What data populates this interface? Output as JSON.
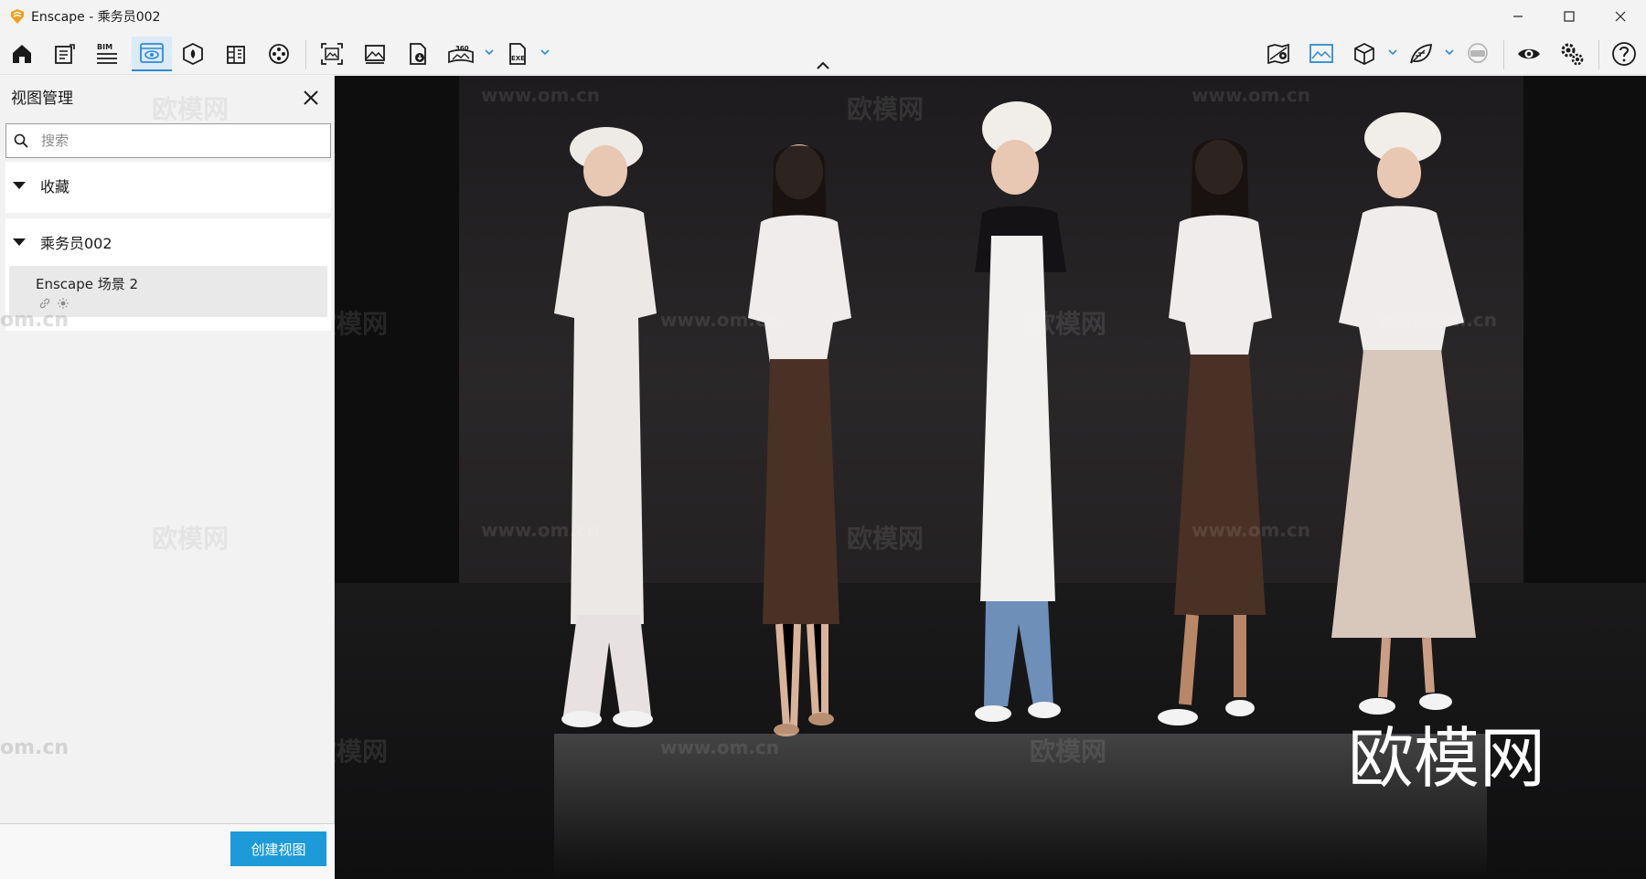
{
  "window": {
    "title": "Enscape - 乘务员002"
  },
  "icons": {
    "toolbar_left": [
      "home-icon",
      "notes-icon",
      "bim-icon",
      "view-management-icon",
      "asset-library-icon",
      "building-icon",
      "video-reel-icon",
      "screenshot-icon",
      "image-render-icon",
      "document-export-icon",
      "panorama-360-icon",
      "exe-export-icon"
    ],
    "toolbar_right": [
      "map-pin-icon",
      "rendered-image-icon",
      "cube-icon",
      "leaf-icon",
      "vr-headset-icon",
      "visibility-eye-icon",
      "settings-gears-icon",
      "help-icon"
    ]
  },
  "toolbar": {
    "bim_label": "BIM",
    "pano_label": "360",
    "exe_label": "EXE"
  },
  "panel": {
    "title": "视图管理",
    "search_placeholder": "搜索",
    "favorites_label": "收藏",
    "scene_group_label": "乘务员002",
    "view_item_name": "Enscape 场景 2",
    "create_view_label": "创建视图"
  },
  "viewport": {
    "watermark_brand": "欧模网",
    "watermark_url": "www.om.cn",
    "watermark_side": "om.cn"
  },
  "colors": {
    "accent": "#1d9bd8",
    "active_tab": "#dbeaf6",
    "logo": "#f0a01e"
  }
}
